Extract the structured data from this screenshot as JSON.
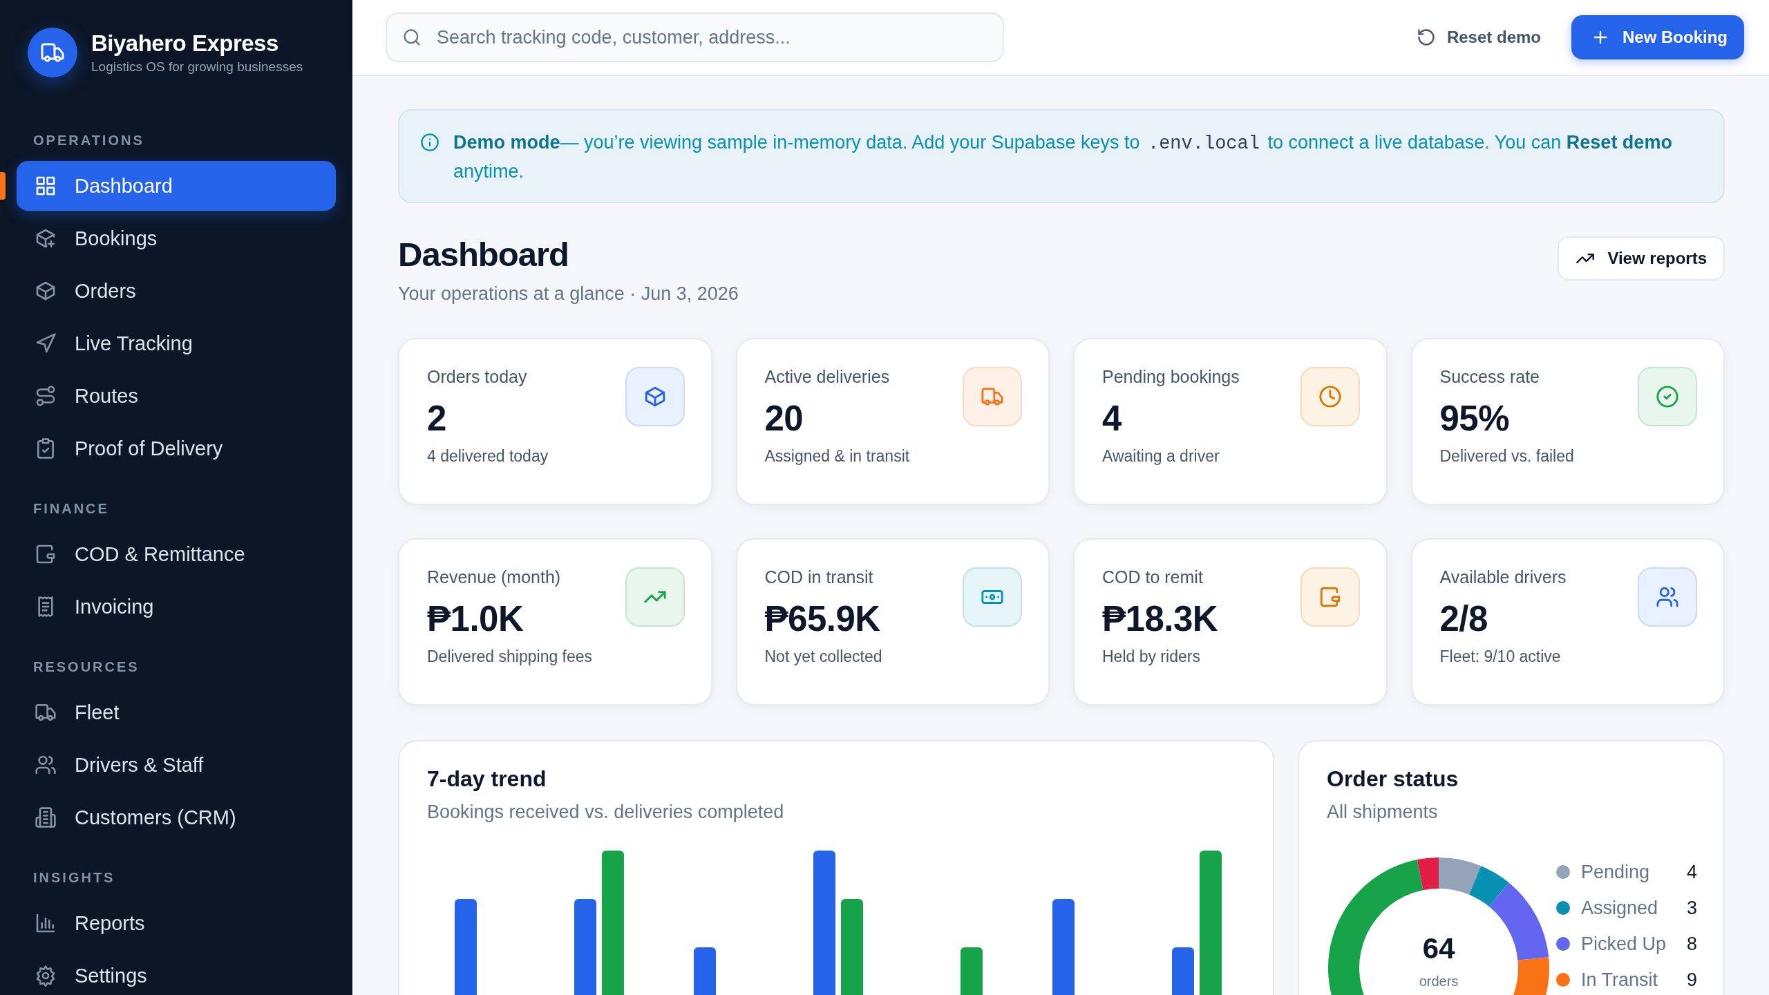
{
  "brand": {
    "name": "Biyahero Express",
    "tagline": "Logistics OS for growing businesses"
  },
  "sidebar": {
    "sections": [
      {
        "title": "OPERATIONS",
        "items": [
          {
            "label": "Dashboard",
            "selected": true
          },
          {
            "label": "Bookings",
            "selected": false
          },
          {
            "label": "Orders",
            "selected": false
          },
          {
            "label": "Live Tracking",
            "selected": false
          },
          {
            "label": "Routes",
            "selected": false
          },
          {
            "label": "Proof of Delivery",
            "selected": false
          }
        ]
      },
      {
        "title": "FINANCE",
        "items": [
          {
            "label": "COD & Remittance",
            "selected": false
          },
          {
            "label": "Invoicing",
            "selected": false
          }
        ]
      },
      {
        "title": "RESOURCES",
        "items": [
          {
            "label": "Fleet",
            "selected": false
          },
          {
            "label": "Drivers & Staff",
            "selected": false
          },
          {
            "label": "Customers (CRM)",
            "selected": false
          }
        ]
      },
      {
        "title": "INSIGHTS",
        "items": [
          {
            "label": "Reports",
            "selected": false
          },
          {
            "label": "Settings",
            "selected": false
          }
        ]
      }
    ]
  },
  "topbar": {
    "search": {
      "placeholder": "Search tracking code, customer, address..."
    },
    "reset_button": "Reset demo",
    "new_button": "New Booking"
  },
  "notice": {
    "parts": [
      {
        "kind": "bold",
        "text": "Demo mode"
      },
      {
        "kind": "text",
        "text": "— you’re viewing sample in-memory data. Add your Supabase keys to "
      },
      {
        "kind": "code",
        "text": ".env.local"
      },
      {
        "kind": "text",
        "text": " to connect a live database. You can "
      },
      {
        "kind": "bold",
        "text": "Reset demo"
      },
      {
        "kind": "text",
        "text": " anytime."
      }
    ]
  },
  "header": {
    "title": "Dashboard",
    "subtitle": "Your operations at a glance · Jun 3, 2026",
    "reports_button": "View reports"
  },
  "stats": [
    {
      "label": "Orders today",
      "value": "2",
      "note": "4 delivered today"
    },
    {
      "label": "Active deliveries",
      "value": "20",
      "note": "Assigned & in transit"
    },
    {
      "label": "Pending bookings",
      "value": "4",
      "note": "Awaiting a driver"
    },
    {
      "label": "Success rate",
      "value": "95%",
      "note": "Delivered vs. failed"
    },
    {
      "label": "Revenue (month)",
      "value": "₱1.0K",
      "note": "Delivered shipping fees"
    },
    {
      "label": "COD in transit",
      "value": "₱65.9K",
      "note": "Not yet collected"
    },
    {
      "label": "COD to remit",
      "value": "₱18.3K",
      "note": "Held by riders"
    },
    {
      "label": "Available drivers",
      "value": "2/8",
      "note": "Fleet: 9/10 active"
    }
  ],
  "trend": {
    "title": "7-day trend",
    "subtitle": "Bookings received vs. deliveries completed"
  },
  "order_status": {
    "title": "Order status",
    "subtitle": "All shipments",
    "total": "64",
    "total_label": "orders",
    "legend": [
      {
        "label": "Pending",
        "value": "4",
        "color": "#94a3b8"
      },
      {
        "label": "Assigned",
        "value": "3",
        "color": "#0891b2"
      },
      {
        "label": "Picked Up",
        "value": "8",
        "color": "#6366f1"
      },
      {
        "label": "In Transit",
        "value": "9",
        "color": "#f97316"
      }
    ],
    "chart_data": {
      "type": "donut",
      "values": [
        6.25,
        4.6875,
        12.5,
        14.0625,
        59.375,
        3.125
      ],
      "colors": [
        "#94a3b8",
        "#0891b2",
        "#6366f1",
        "#f97316",
        "#16a34a",
        "#e11d48"
      ]
    }
  }
}
